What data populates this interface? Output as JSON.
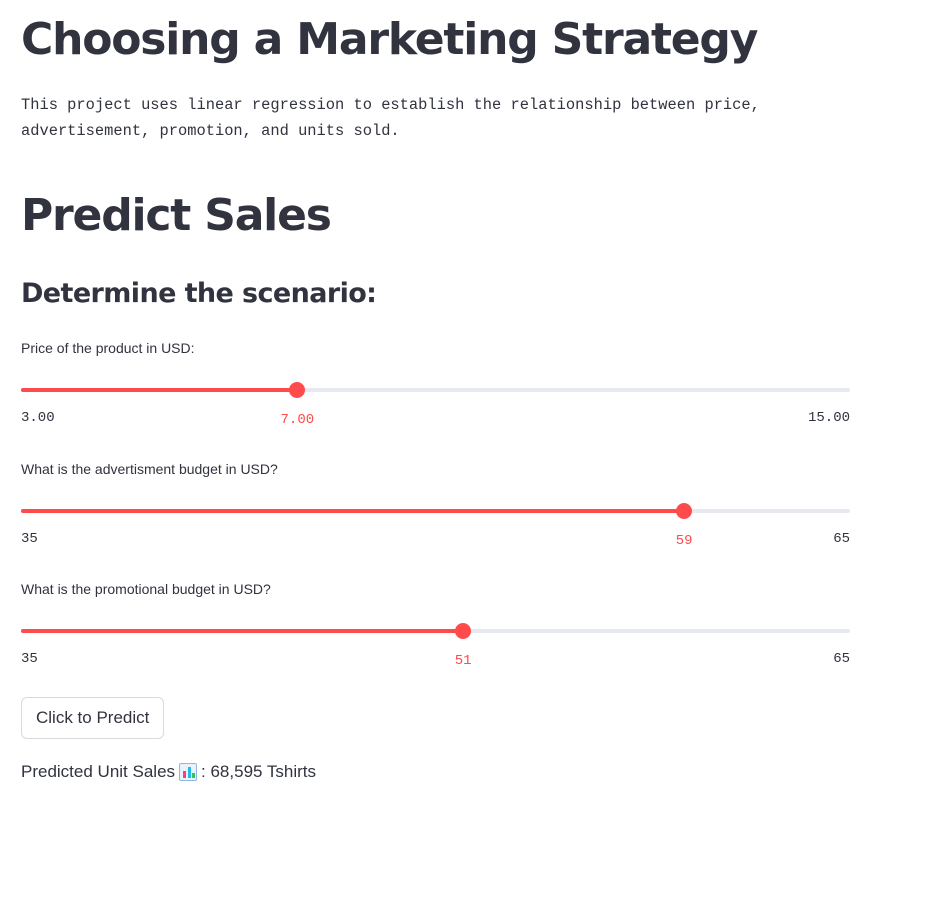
{
  "page": {
    "title": "Choosing a Marketing Strategy",
    "description": "This project uses linear regression to establish the relationship between price, advertisement, promotion, and units sold.",
    "section_title": "Predict Sales",
    "subsection_title": "Determine the scenario:"
  },
  "sliders": [
    {
      "label": "Price of the product in USD:",
      "value": 7.0,
      "value_text": "7.00",
      "min": 3.0,
      "max": 15.0,
      "min_text": "3.00",
      "max_text": "15.00"
    },
    {
      "label": "What is the advertisment budget in USD?",
      "value": 59,
      "value_text": "59",
      "min": 35,
      "max": 65,
      "min_text": "35",
      "max_text": "65"
    },
    {
      "label": "What is the promotional budget in USD?",
      "value": 51,
      "value_text": "51",
      "min": 35,
      "max": 65,
      "min_text": "35",
      "max_text": "65"
    }
  ],
  "predict_button": {
    "label": "Click to Predict"
  },
  "result": {
    "prefix": "Predicted Unit Sales",
    "icon": "bar-chart-icon",
    "suffix": ": 68,595 Tshirts"
  },
  "colors": {
    "accent": "#ff4b4b",
    "track": "#e6e9ef",
    "text": "#31333f",
    "background": "#ffffff"
  }
}
